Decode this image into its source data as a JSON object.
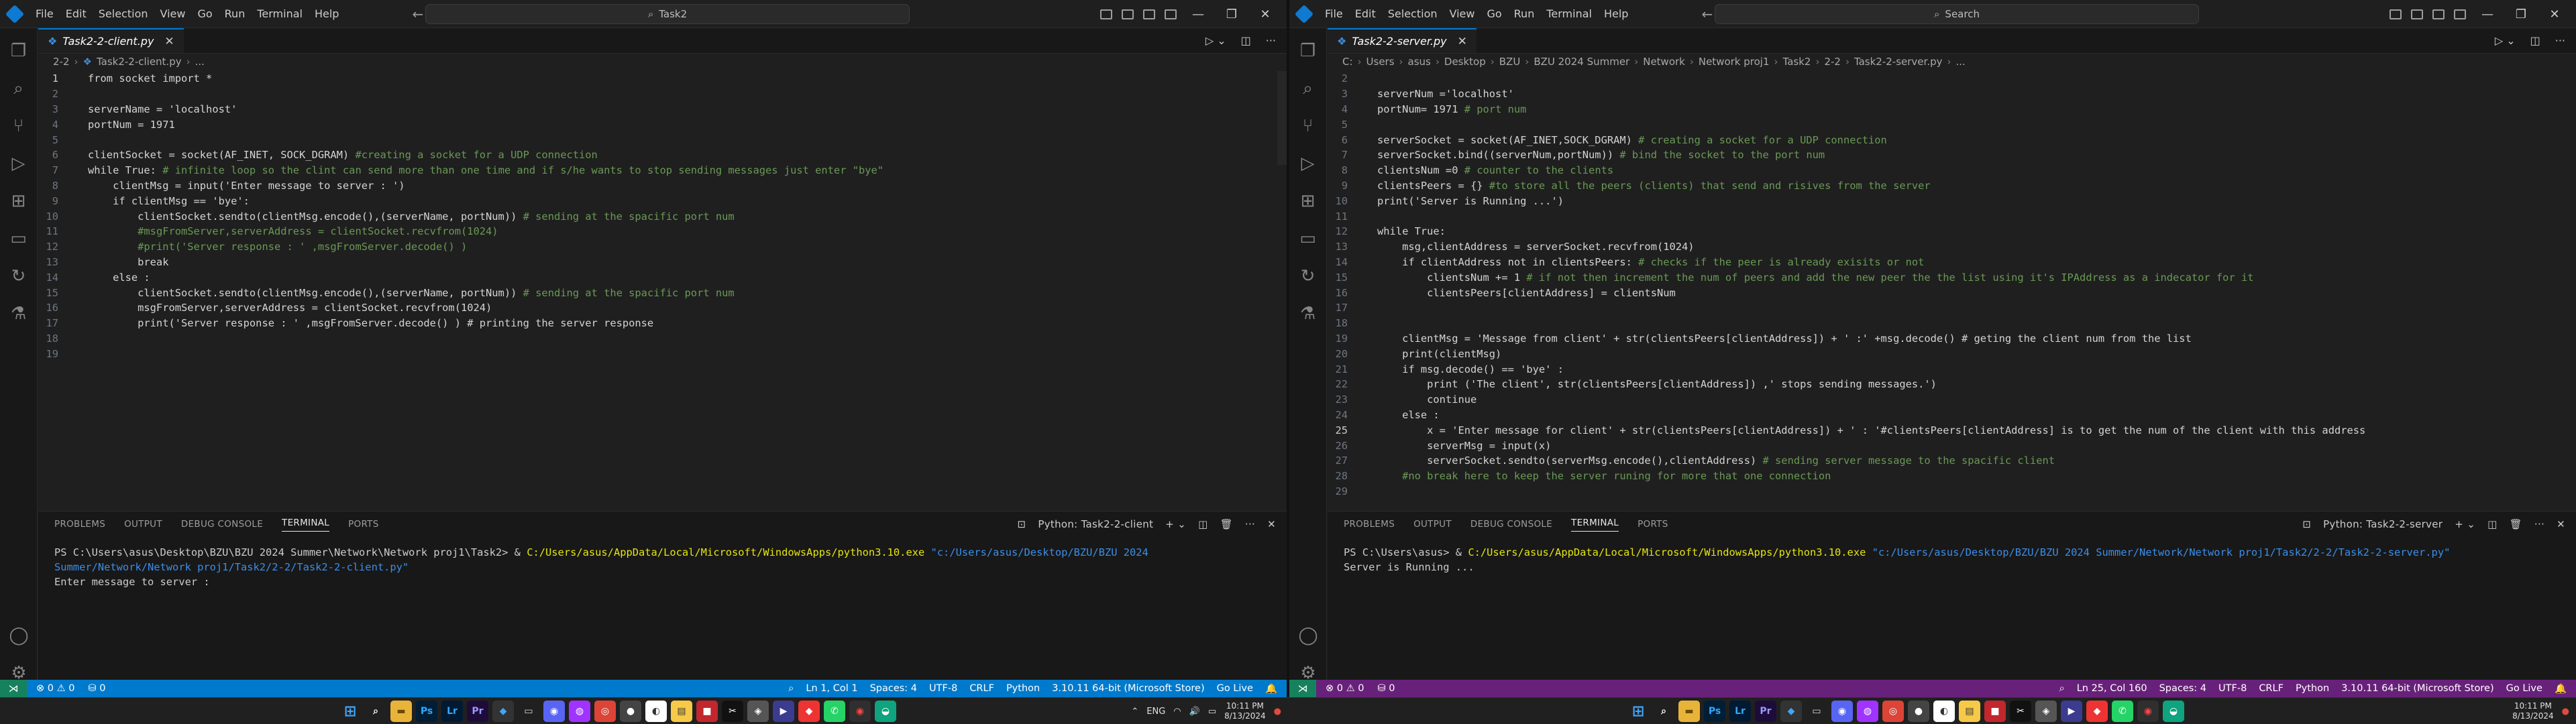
{
  "left": {
    "menu": [
      "File",
      "Edit",
      "Selection",
      "View",
      "Go",
      "Run",
      "Terminal",
      "Help"
    ],
    "search": "Task2",
    "tab": "Task2-2-client.py",
    "breadcrumb": [
      "2-2",
      "Task2-2-client.py",
      "..."
    ],
    "code": [
      "from socket import *",
      "",
      "serverName = 'localhost'",
      "portNum = 1971",
      "",
      "clientSocket = socket(AF_INET, SOCK_DGRAM) #creating a socket for a UDP connection",
      "while True: # infinite loop so the clint can send more than one time and if s/he wants to stop sending messages just enter \"bye\"",
      "    clientMsg = input('Enter message to server : ')",
      "    if clientMsg == 'bye':",
      "        clientSocket.sendto(clientMsg.encode(),(serverName, portNum)) # sending at the spacific port num",
      "        #msgFromServer,serverAddress = clientSocket.recvfrom(1024)",
      "        #print('Server response : ' ,msgFromServer.decode() )",
      "        break",
      "    else :",
      "        clientSocket.sendto(clientMsg.encode(),(serverName, portNum)) # sending at the spacific port num",
      "        msgFromServer,serverAddress = clientSocket.recvfrom(1024)",
      "        print('Server response : ' ,msgFromServer.decode() ) # printing the server response",
      "",
      ""
    ],
    "panel_tabs": [
      "PROBLEMS",
      "OUTPUT",
      "DEBUG CONSOLE",
      "TERMINAL",
      "PORTS"
    ],
    "terminal_name": "Python: Task2-2-client",
    "terminal": {
      "prompt": "PS C:\\Users\\asus\\Desktop\\BZU\\BZU 2024 Summer\\Network\\Network proj1\\Task2> & ",
      "exe": "C:/Users/asus/AppData/Local/Microsoft/WindowsApps/python3.10.exe",
      "script": " \"c:/Users/asus/Desktop/BZU/BZU 2024 Summer/Network/Network proj1/Task2/2-2/Task2-2-client.py\"",
      "out": "Enter message to server :"
    },
    "status": {
      "errors": "⊗ 0 ⚠ 0",
      "ports": "⛁ 0",
      "cursor": "Ln 1, Col 1",
      "spaces": "Spaces: 4",
      "encoding": "UTF-8",
      "eol": "CRLF",
      "lang": "Python",
      "interp": "3.10.11 64-bit (Microsoft Store)",
      "golive": "Go Live"
    }
  },
  "right": {
    "menu": [
      "File",
      "Edit",
      "Selection",
      "View",
      "Go",
      "Run",
      "Terminal",
      "Help"
    ],
    "search": "Search",
    "tab": "Task2-2-server.py",
    "breadcrumb": [
      "C:",
      "Users",
      "asus",
      "Desktop",
      "BZU",
      "BZU 2024 Summer",
      "Network",
      "Network proj1",
      "Task2",
      "2-2",
      "Task2-2-server.py",
      "..."
    ],
    "code_start": 2,
    "code": [
      "",
      "serverNum ='localhost'",
      "portNum= 1971 # port num",
      "",
      "serverSocket = socket(AF_INET,SOCK_DGRAM) # creating a socket for a UDP connection",
      "serverSocket.bind((serverNum,portNum)) # bind the socket to the port num",
      "clientsNum =0 # counter to the clients",
      "clientsPeers = {} #to store all the peers (clients) that send and risives from the server",
      "print('Server is Running ...')",
      "",
      "while True:",
      "    msg,clientAddress = serverSocket.recvfrom(1024)",
      "    if clientAddress not in clientsPeers: # checks if the peer is already exisits or not",
      "        clientsNum += 1 # if not then increment the num of peers and add the new peer the the list using it's IPAddress as a indecator for it",
      "        clientsPeers[clientAddress] = clientsNum",
      "",
      "",
      "    clientMsg = 'Message from client' + str(clientsPeers[clientAddress]) + ' :' +msg.decode() # geting the client num from the list",
      "    print(clientMsg)",
      "    if msg.decode() == 'bye' :",
      "        print ('The client', str(clientsPeers[clientAddress]) ,' stops sending messages.')",
      "        continue",
      "    else :",
      "        x = 'Enter message for client' + str(clientsPeers[clientAddress]) + ' : '#clientsPeers[clientAddress] is to get the num of the client with this address",
      "        serverMsg = input(x)",
      "        serverSocket.sendto(serverMsg.encode(),clientAddress) # sending server message to the spacific client",
      "    #no break here to keep the server runing for more that one connection",
      ""
    ],
    "panel_tabs": [
      "PROBLEMS",
      "OUTPUT",
      "DEBUG CONSOLE",
      "TERMINAL",
      "PORTS"
    ],
    "terminal_name": "Python: Task2-2-server",
    "terminal": {
      "prompt": "PS C:\\Users\\asus> & ",
      "exe": "C:/Users/asus/AppData/Local/Microsoft/WindowsApps/python3.10.exe",
      "script": " \"c:/Users/asus/Desktop/BZU/BZU 2024 Summer/Network/Network proj1/Task2/2-2/Task2-2-server.py\"",
      "out": "Server is Running ..."
    },
    "status": {
      "errors": "⊗ 0 ⚠ 0",
      "ports": "⛁ 0",
      "cursor": "Ln 25, Col 160",
      "spaces": "Spaces: 4",
      "encoding": "UTF-8",
      "eol": "CRLF",
      "lang": "Python",
      "interp": "3.10.11 64-bit (Microsoft Store)",
      "golive": "Go Live"
    }
  },
  "taskbar": {
    "lang": "ENG",
    "time": "10:11 PM",
    "date": "8/13/2024"
  }
}
